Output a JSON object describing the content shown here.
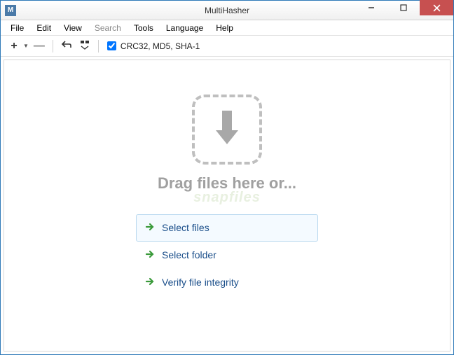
{
  "titlebar": {
    "icon_letter": "M",
    "title": "MultiHasher"
  },
  "menubar": {
    "file": "File",
    "edit": "Edit",
    "view": "View",
    "search": "Search",
    "tools": "Tools",
    "language": "Language",
    "help": "Help"
  },
  "toolbar": {
    "hash_label": "CRC32, MD5, SHA-1",
    "hash_checked": true
  },
  "dropzone": {
    "text": "Drag files here or..."
  },
  "watermark": "snapfiles",
  "actions": {
    "select_files": "Select files",
    "select_folder": "Select folder",
    "verify": "Verify file integrity"
  }
}
